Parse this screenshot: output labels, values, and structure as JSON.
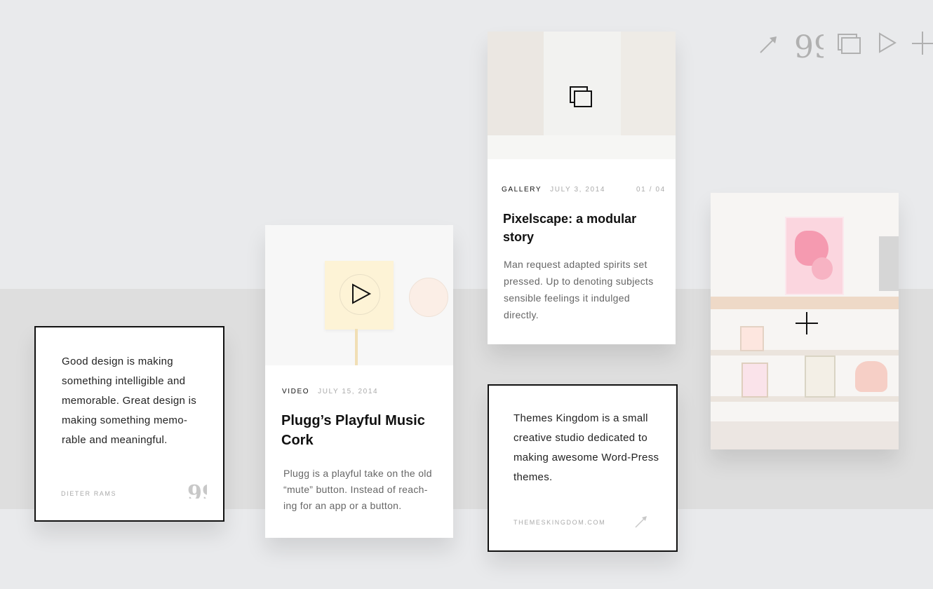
{
  "toolbar": {
    "icons": [
      "link-arrow-icon",
      "quote-icon",
      "gallery-icon",
      "play-icon",
      "plus-icon"
    ]
  },
  "quote_card": {
    "text": "Good design is making something intelligible and memorable. Great design is making something memo-rable and meaningful.",
    "author": "DIETER RAMS",
    "icon": "quote-icon"
  },
  "video_card": {
    "category": "VIDEO",
    "date": "JULY 15, 2014",
    "title": "Plugg’s Playful Music Cork",
    "excerpt": "Plugg is a playful take on the old “mute” button. Instead of reach-ing for an app or a button.",
    "icon": "play-icon"
  },
  "gallery_card": {
    "category": "GALLERY",
    "date": "JULY 3, 2014",
    "counter": "01 / 04",
    "title": "Pixelscape: a modular story",
    "excerpt": "Man request adapted spirits set pressed. Up to denoting subjects sensible feelings it indulged directly.",
    "icon": "gallery-icon"
  },
  "link_card": {
    "text": "Themes Kingdom is a small creative studio dedicated to making awesome Word-Press themes.",
    "url_label": "THEMESKINGDOM.COM",
    "icon": "link-arrow-icon"
  },
  "image_card": {
    "icon": "plus-icon"
  },
  "colors": {
    "background": "#e9eaec",
    "band": "#dedede",
    "accent_pink": "#f07a9a"
  }
}
